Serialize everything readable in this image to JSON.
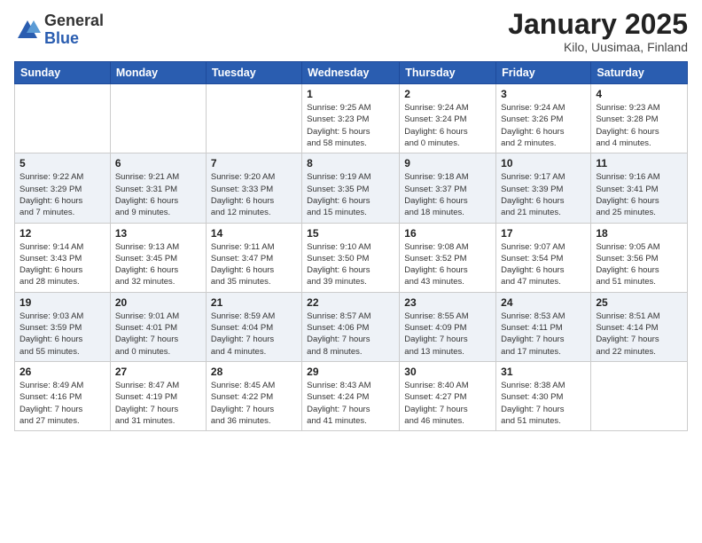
{
  "logo": {
    "general": "General",
    "blue": "Blue"
  },
  "header": {
    "title": "January 2025",
    "subtitle": "Kilo, Uusimaa, Finland"
  },
  "weekdays": [
    "Sunday",
    "Monday",
    "Tuesday",
    "Wednesday",
    "Thursday",
    "Friday",
    "Saturday"
  ],
  "weeks": [
    {
      "days": [
        {
          "num": "",
          "info": ""
        },
        {
          "num": "",
          "info": ""
        },
        {
          "num": "",
          "info": ""
        },
        {
          "num": "1",
          "info": "Sunrise: 9:25 AM\nSunset: 3:23 PM\nDaylight: 5 hours\nand 58 minutes."
        },
        {
          "num": "2",
          "info": "Sunrise: 9:24 AM\nSunset: 3:24 PM\nDaylight: 6 hours\nand 0 minutes."
        },
        {
          "num": "3",
          "info": "Sunrise: 9:24 AM\nSunset: 3:26 PM\nDaylight: 6 hours\nand 2 minutes."
        },
        {
          "num": "4",
          "info": "Sunrise: 9:23 AM\nSunset: 3:28 PM\nDaylight: 6 hours\nand 4 minutes."
        }
      ]
    },
    {
      "days": [
        {
          "num": "5",
          "info": "Sunrise: 9:22 AM\nSunset: 3:29 PM\nDaylight: 6 hours\nand 7 minutes."
        },
        {
          "num": "6",
          "info": "Sunrise: 9:21 AM\nSunset: 3:31 PM\nDaylight: 6 hours\nand 9 minutes."
        },
        {
          "num": "7",
          "info": "Sunrise: 9:20 AM\nSunset: 3:33 PM\nDaylight: 6 hours\nand 12 minutes."
        },
        {
          "num": "8",
          "info": "Sunrise: 9:19 AM\nSunset: 3:35 PM\nDaylight: 6 hours\nand 15 minutes."
        },
        {
          "num": "9",
          "info": "Sunrise: 9:18 AM\nSunset: 3:37 PM\nDaylight: 6 hours\nand 18 minutes."
        },
        {
          "num": "10",
          "info": "Sunrise: 9:17 AM\nSunset: 3:39 PM\nDaylight: 6 hours\nand 21 minutes."
        },
        {
          "num": "11",
          "info": "Sunrise: 9:16 AM\nSunset: 3:41 PM\nDaylight: 6 hours\nand 25 minutes."
        }
      ]
    },
    {
      "days": [
        {
          "num": "12",
          "info": "Sunrise: 9:14 AM\nSunset: 3:43 PM\nDaylight: 6 hours\nand 28 minutes."
        },
        {
          "num": "13",
          "info": "Sunrise: 9:13 AM\nSunset: 3:45 PM\nDaylight: 6 hours\nand 32 minutes."
        },
        {
          "num": "14",
          "info": "Sunrise: 9:11 AM\nSunset: 3:47 PM\nDaylight: 6 hours\nand 35 minutes."
        },
        {
          "num": "15",
          "info": "Sunrise: 9:10 AM\nSunset: 3:50 PM\nDaylight: 6 hours\nand 39 minutes."
        },
        {
          "num": "16",
          "info": "Sunrise: 9:08 AM\nSunset: 3:52 PM\nDaylight: 6 hours\nand 43 minutes."
        },
        {
          "num": "17",
          "info": "Sunrise: 9:07 AM\nSunset: 3:54 PM\nDaylight: 6 hours\nand 47 minutes."
        },
        {
          "num": "18",
          "info": "Sunrise: 9:05 AM\nSunset: 3:56 PM\nDaylight: 6 hours\nand 51 minutes."
        }
      ]
    },
    {
      "days": [
        {
          "num": "19",
          "info": "Sunrise: 9:03 AM\nSunset: 3:59 PM\nDaylight: 6 hours\nand 55 minutes."
        },
        {
          "num": "20",
          "info": "Sunrise: 9:01 AM\nSunset: 4:01 PM\nDaylight: 7 hours\nand 0 minutes."
        },
        {
          "num": "21",
          "info": "Sunrise: 8:59 AM\nSunset: 4:04 PM\nDaylight: 7 hours\nand 4 minutes."
        },
        {
          "num": "22",
          "info": "Sunrise: 8:57 AM\nSunset: 4:06 PM\nDaylight: 7 hours\nand 8 minutes."
        },
        {
          "num": "23",
          "info": "Sunrise: 8:55 AM\nSunset: 4:09 PM\nDaylight: 7 hours\nand 13 minutes."
        },
        {
          "num": "24",
          "info": "Sunrise: 8:53 AM\nSunset: 4:11 PM\nDaylight: 7 hours\nand 17 minutes."
        },
        {
          "num": "25",
          "info": "Sunrise: 8:51 AM\nSunset: 4:14 PM\nDaylight: 7 hours\nand 22 minutes."
        }
      ]
    },
    {
      "days": [
        {
          "num": "26",
          "info": "Sunrise: 8:49 AM\nSunset: 4:16 PM\nDaylight: 7 hours\nand 27 minutes."
        },
        {
          "num": "27",
          "info": "Sunrise: 8:47 AM\nSunset: 4:19 PM\nDaylight: 7 hours\nand 31 minutes."
        },
        {
          "num": "28",
          "info": "Sunrise: 8:45 AM\nSunset: 4:22 PM\nDaylight: 7 hours\nand 36 minutes."
        },
        {
          "num": "29",
          "info": "Sunrise: 8:43 AM\nSunset: 4:24 PM\nDaylight: 7 hours\nand 41 minutes."
        },
        {
          "num": "30",
          "info": "Sunrise: 8:40 AM\nSunset: 4:27 PM\nDaylight: 7 hours\nand 46 minutes."
        },
        {
          "num": "31",
          "info": "Sunrise: 8:38 AM\nSunset: 4:30 PM\nDaylight: 7 hours\nand 51 minutes."
        },
        {
          "num": "",
          "info": ""
        }
      ]
    }
  ]
}
